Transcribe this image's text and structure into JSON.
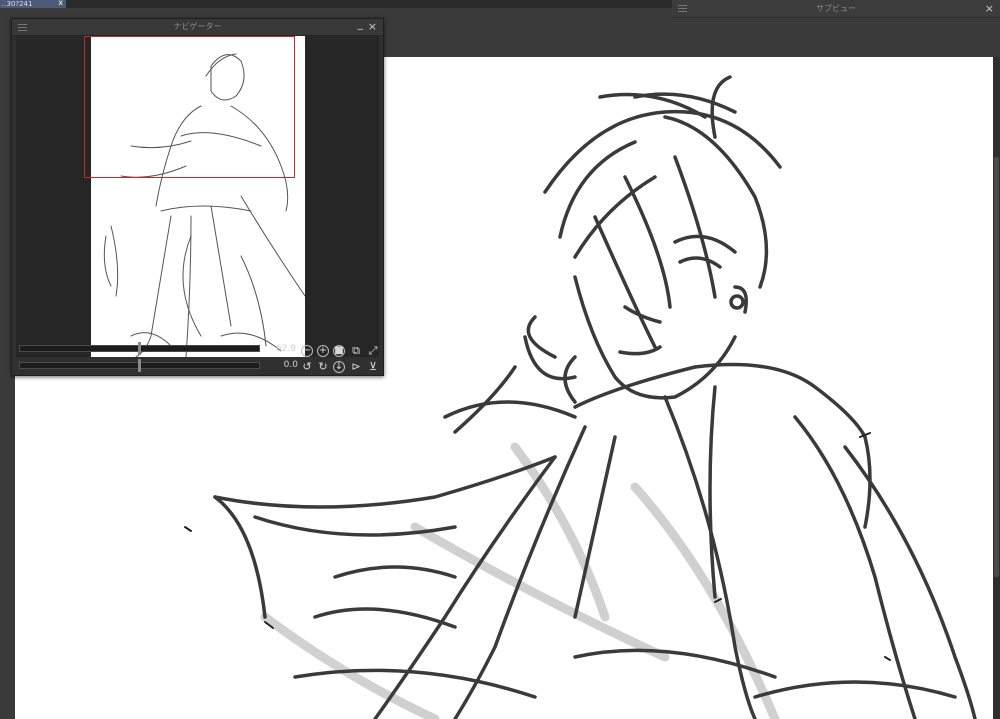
{
  "document_tab": {
    "title": "..30?241",
    "close_glyph": "x"
  },
  "subview": {
    "title": "サブビュー",
    "close_glyph": "×"
  },
  "navigator": {
    "title": "ナビゲーター",
    "minimize_glyph": "_",
    "close_glyph": "×",
    "zoom_value": "62.9",
    "angle_value": "0.0",
    "zoom_slider_level": 0.5,
    "angle_slider_level": 0.5
  },
  "colors": {
    "viewport_frame": "#c0282a",
    "panel_bg": "#303030",
    "canvas": "#ffffff"
  }
}
